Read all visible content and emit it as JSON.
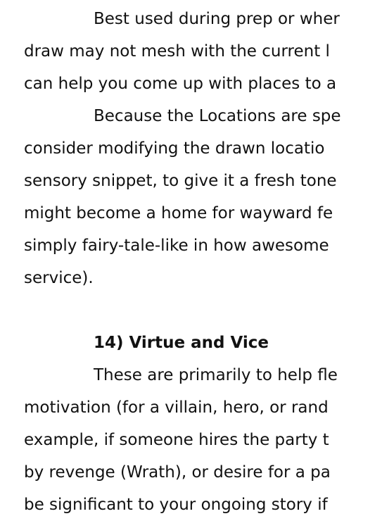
{
  "document": {
    "paragraph_1": [
      "Best used during prep or wher",
      "draw may not mesh with the current l",
      "can help you come up with places to a"
    ],
    "paragraph_2": [
      "Because the Locations are spe",
      "consider modifying the drawn locatio",
      "sensory snippet, to give it a fresh tone",
      "might become a home for wayward fe",
      "simply fairy-tale-like in how awesome",
      "service)."
    ],
    "section_heading": "14) Virtue and Vice",
    "paragraph_3": [
      "These are primarily to help fle",
      "motivation (for a villain, hero, or rand",
      "example, if someone hires the party t",
      "by revenge (Wrath), or desire for a pa",
      "be significant to your ongoing story if"
    ]
  }
}
